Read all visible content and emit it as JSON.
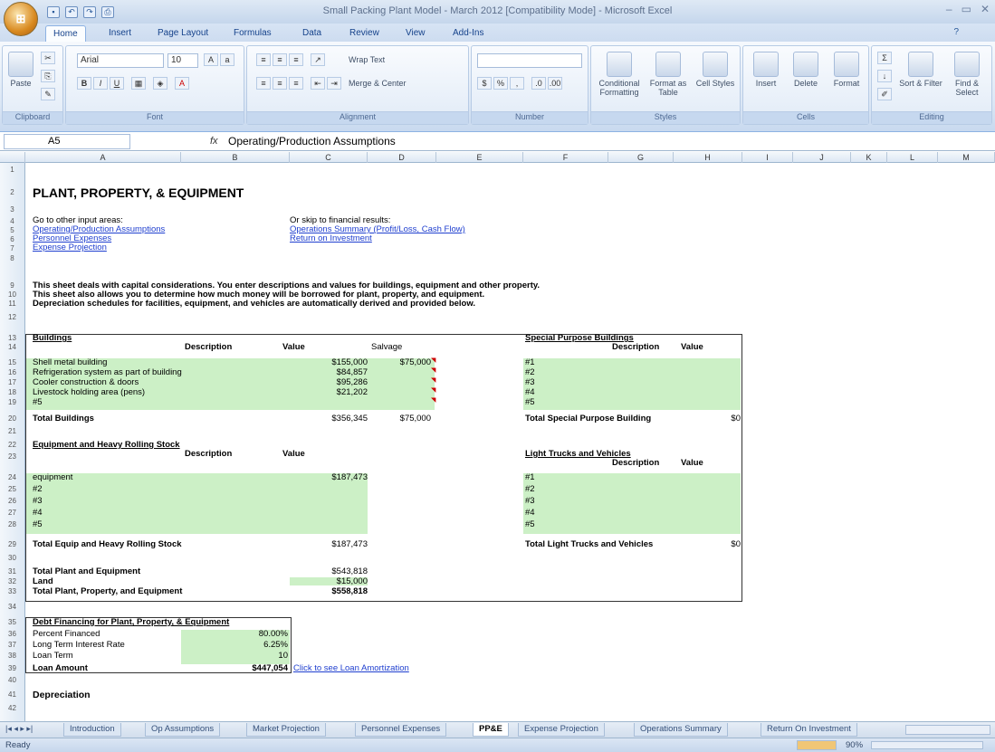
{
  "window": {
    "title": "Small Packing Plant Model - March 2012  [Compatibility Mode] - Microsoft Excel"
  },
  "ribbon_tabs": [
    "Home",
    "Insert",
    "Page Layout",
    "Formulas",
    "Data",
    "Review",
    "View",
    "Add-Ins"
  ],
  "ribbon": {
    "paste": "Paste",
    "font_name": "Arial",
    "font_size": "10",
    "wrap_text": "Wrap Text",
    "merge_center": "Merge & Center",
    "conditional_formatting": "Conditional Formatting",
    "format_as_table": "Format as Table",
    "cell_styles": "Cell Styles",
    "insert": "Insert",
    "delete": "Delete",
    "format": "Format",
    "sort_filter": "Sort & Filter",
    "find_select": "Find & Select",
    "groups": [
      "Clipboard",
      "Font",
      "Alignment",
      "Number",
      "Styles",
      "Cells",
      "Editing"
    ]
  },
  "formula_bar": {
    "name_box": "A5",
    "fx": "fx",
    "content": "Operating/Production Assumptions"
  },
  "columns": [
    "A",
    "B",
    "C",
    "D",
    "E",
    "F",
    "G",
    "H",
    "I",
    "J",
    "K",
    "L",
    "M"
  ],
  "rows": [
    "1",
    "2",
    "3",
    "4",
    "5",
    "6",
    "7",
    "8",
    "9",
    "10",
    "11",
    "12",
    "13",
    "14",
    "15",
    "16",
    "17",
    "18",
    "19",
    "20",
    "21",
    "22",
    "23",
    "24",
    "25",
    "26",
    "27",
    "28",
    "29",
    "30",
    "31",
    "32",
    "33",
    "34",
    "35",
    "36",
    "37",
    "38",
    "39",
    "40",
    "41",
    "42"
  ],
  "sheet": {
    "title": "PLANT, PROPERTY, & EQUIPMENT",
    "goto_label": "Go to other input areas:",
    "goto_links": [
      "Operating/Production Assumptions",
      "Personnel Expenses",
      "Expense Projection"
    ],
    "skip_label": "Or skip to financial results:",
    "skip_links": [
      "Operations Summary (Profit/Loss, Cash Flow)",
      "Return on Investment"
    ],
    "intro": [
      "This sheet deals with capital considerations.  You enter descriptions and values for buildings, equipment and other property.",
      "This sheet also allows you to determine how much money will be borrowed for plant, property, and equipment.",
      "Depreciation schedules for facilities, equipment, and vehicles are automatically derived and provided below."
    ],
    "buildings": {
      "header": "Buildings",
      "col_desc": "Description",
      "col_value": "Value",
      "col_salvage": "Salvage",
      "rows": [
        {
          "desc": "Shell metal building",
          "value": "$155,000",
          "salvage": "$75,000"
        },
        {
          "desc": "Refrigeration system as part of building",
          "value": "$84,857",
          "salvage": ""
        },
        {
          "desc": "Cooler construction & doors",
          "value": "$95,286",
          "salvage": ""
        },
        {
          "desc": "Livestock holding area (pens)",
          "value": "$21,202",
          "salvage": ""
        },
        {
          "desc": "#5",
          "value": "",
          "salvage": ""
        }
      ],
      "total_label": "Total Buildings",
      "total_value": "$356,345",
      "total_salvage": "$75,000"
    },
    "special": {
      "header": "Special Purpose Buildings",
      "col_desc": "Description",
      "col_value": "Value",
      "rows": [
        "#1",
        "#2",
        "#3",
        "#4",
        "#5"
      ],
      "total_label": "Total Special Purpose Building",
      "total_value": "$0"
    },
    "equipment": {
      "header": "Equipment and Heavy Rolling Stock",
      "col_desc": "Description",
      "col_value": "Value",
      "rows": [
        {
          "desc": "equipment",
          "value": "$187,473"
        },
        {
          "desc": "#2",
          "value": ""
        },
        {
          "desc": "#3",
          "value": ""
        },
        {
          "desc": "#4",
          "value": ""
        },
        {
          "desc": "#5",
          "value": ""
        }
      ],
      "total_label": "Total Equip and Heavy Rolling Stock",
      "total_value": "$187,473"
    },
    "trucks": {
      "header": "Light Trucks and Vehicles",
      "col_desc": "Description",
      "col_value": "Value",
      "rows": [
        "#1",
        "#2",
        "#3",
        "#4",
        "#5"
      ],
      "total_label": "Total Light Trucks and Vehicles",
      "total_value": "$0"
    },
    "totals": {
      "plant_equip_label": "Total Plant and Equipment",
      "plant_equip_value": "$543,818",
      "land_label": "Land",
      "land_value": "$15,000",
      "ppe_label": "Total Plant, Property, and Equipment",
      "ppe_value": "$558,818"
    },
    "debt": {
      "header": "Debt Financing  for Plant, Property, & Equipment",
      "percent_label": "Percent Financed",
      "percent_value": "80.00%",
      "rate_label": "Long Term Interest Rate",
      "rate_value": "6.25%",
      "term_label": "Loan Term",
      "term_value": "10",
      "amount_label": "Loan Amount",
      "amount_value": "$447,054",
      "amort_link": "Click to see Loan Amortization"
    },
    "depreciation": "Depreciation"
  },
  "sheet_tabs": [
    "Introduction",
    "Op Assumptions",
    "Market Projection",
    "Personnel Expenses",
    "PP&E",
    "Expense Projection",
    "Operations Summary",
    "Return On Investment"
  ],
  "active_sheet": "PP&E",
  "status": {
    "ready": "Ready",
    "zoom": "90%"
  },
  "colors": {
    "input_fill": "#ccf0c6",
    "link": "#1f3fcf"
  }
}
